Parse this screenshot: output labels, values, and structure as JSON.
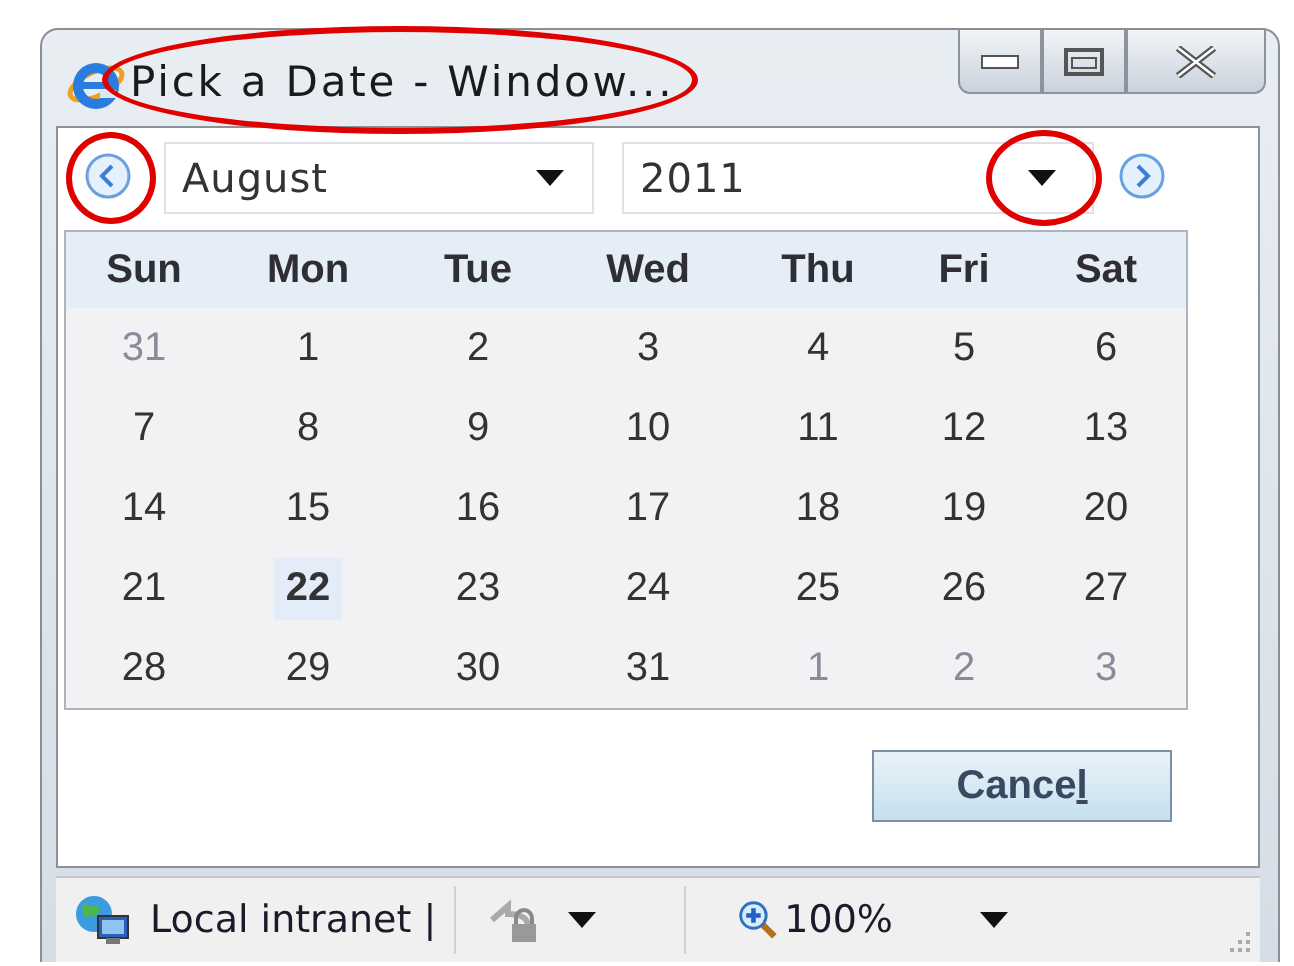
{
  "window": {
    "title": "Pick a Date - Window...",
    "title_circled": true
  },
  "navigation": {
    "prev_circled": true,
    "month": "August",
    "year": "2011",
    "year_arrow_circled": true
  },
  "calendar": {
    "weekdays": [
      "Sun",
      "Mon",
      "Tue",
      "Wed",
      "Thu",
      "Fri",
      "Sat"
    ],
    "weeks": [
      [
        {
          "day": "31",
          "other_month": true,
          "today": false
        },
        {
          "day": "1",
          "other_month": false,
          "today": false
        },
        {
          "day": "2",
          "other_month": false,
          "today": false
        },
        {
          "day": "3",
          "other_month": false,
          "today": false
        },
        {
          "day": "4",
          "other_month": false,
          "today": false
        },
        {
          "day": "5",
          "other_month": false,
          "today": false
        },
        {
          "day": "6",
          "other_month": false,
          "today": false
        }
      ],
      [
        {
          "day": "7",
          "other_month": false,
          "today": false
        },
        {
          "day": "8",
          "other_month": false,
          "today": false
        },
        {
          "day": "9",
          "other_month": false,
          "today": false
        },
        {
          "day": "10",
          "other_month": false,
          "today": false
        },
        {
          "day": "11",
          "other_month": false,
          "today": false
        },
        {
          "day": "12",
          "other_month": false,
          "today": false
        },
        {
          "day": "13",
          "other_month": false,
          "today": false
        }
      ],
      [
        {
          "day": "14",
          "other_month": false,
          "today": false
        },
        {
          "day": "15",
          "other_month": false,
          "today": false
        },
        {
          "day": "16",
          "other_month": false,
          "today": false
        },
        {
          "day": "17",
          "other_month": false,
          "today": false
        },
        {
          "day": "18",
          "other_month": false,
          "today": false
        },
        {
          "day": "19",
          "other_month": false,
          "today": false
        },
        {
          "day": "20",
          "other_month": false,
          "today": false
        }
      ],
      [
        {
          "day": "21",
          "other_month": false,
          "today": false
        },
        {
          "day": "22",
          "other_month": false,
          "today": true
        },
        {
          "day": "23",
          "other_month": false,
          "today": false
        },
        {
          "day": "24",
          "other_month": false,
          "today": false
        },
        {
          "day": "25",
          "other_month": false,
          "today": false
        },
        {
          "day": "26",
          "other_month": false,
          "today": false
        },
        {
          "day": "27",
          "other_month": false,
          "today": false
        }
      ],
      [
        {
          "day": "28",
          "other_month": false,
          "today": false
        },
        {
          "day": "29",
          "other_month": false,
          "today": false
        },
        {
          "day": "30",
          "other_month": false,
          "today": false
        },
        {
          "day": "31",
          "other_month": false,
          "today": false
        },
        {
          "day": "1",
          "other_month": true,
          "today": false
        },
        {
          "day": "2",
          "other_month": true,
          "today": false
        },
        {
          "day": "3",
          "other_month": true,
          "today": false
        }
      ]
    ]
  },
  "buttons": [
    {
      "label_before": "Cance",
      "access_key": "l"
    }
  ],
  "status_bar": {
    "zone": "Local intranet |",
    "zoom": "100%"
  }
}
